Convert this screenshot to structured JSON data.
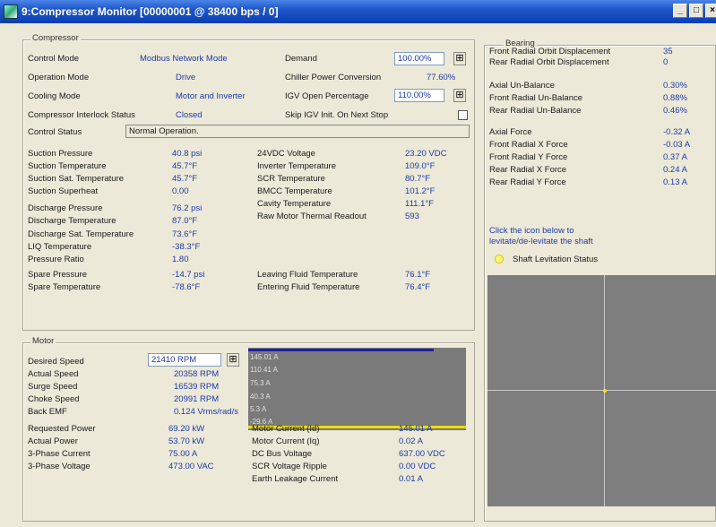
{
  "window": {
    "title": "9:Compressor Monitor [00000001 @ 38400 bps / 0]",
    "minimize": "_",
    "maximize": "□",
    "close": "×"
  },
  "compressor": {
    "group_title": "Compressor",
    "control_mode_label": "Control Mode",
    "control_mode_value": "Modbus Network Mode",
    "operation_mode_label": "Operation Mode",
    "operation_mode_value": "Drive",
    "cooling_mode_label": "Cooling Mode",
    "cooling_mode_value": "Motor and Inverter",
    "interlock_label": "Compressor Interlock Status",
    "interlock_value": "Closed",
    "control_status_label": "Control Status",
    "control_status_value": "Normal Operation.",
    "demand_label": "Demand",
    "demand_value": "100.00%",
    "chiller_power_label": "Chiller Power Conversion",
    "chiller_power_value": "77.60%",
    "igv_label": "IGV Open Percentage",
    "igv_value": "110.00%",
    "skip_igv_label": "Skip IGV Init. On Next Stop",
    "left_readings": [
      {
        "label": "Suction Pressure",
        "value": "40.8 psi"
      },
      {
        "label": "Suction Temperature",
        "value": "45.7°F"
      },
      {
        "label": "Suction Sat. Temperature",
        "value": "45.7°F"
      },
      {
        "label": "Suction Superheat",
        "value": "0.00"
      },
      {
        "label": "Discharge Pressure",
        "value": "76.2 psi"
      },
      {
        "label": "Discharge Temperature",
        "value": "87.0°F"
      },
      {
        "label": "Discharge Sat. Temperature",
        "value": "73.6°F"
      },
      {
        "label": "LIQ Temperature",
        "value": "-38.3°F"
      },
      {
        "label": "Pressure Ratio",
        "value": "1.80"
      },
      {
        "label": "Spare Pressure",
        "value": "-14.7 psi"
      },
      {
        "label": "Spare Temperature",
        "value": "-78.6°F"
      }
    ],
    "right_readings": [
      {
        "label": "24VDC Voltage",
        "value": "23.20 VDC"
      },
      {
        "label": "Inverter Temperature",
        "value": "109.0°F"
      },
      {
        "label": "SCR Temperature",
        "value": "80.7°F"
      },
      {
        "label": "BMCC Temperature",
        "value": "101.2°F"
      },
      {
        "label": "Cavity Temperature",
        "value": "111.1°F"
      },
      {
        "label": "Raw Motor Thermal Readout",
        "value": "593"
      },
      {
        "label": "Leaving Fluid Temperature",
        "value": "76.1°F"
      },
      {
        "label": "Entering Fluid Temperature",
        "value": "76.4°F"
      }
    ]
  },
  "motor": {
    "group_title": "Motor",
    "desired_speed_label": "Desired Speed",
    "desired_speed_value": "21410 RPM",
    "speeds": [
      {
        "label": "Actual Speed",
        "value": "20358 RPM"
      },
      {
        "label": "Surge Speed",
        "value": "16539 RPM"
      },
      {
        "label": "Choke Speed",
        "value": "20991 RPM"
      },
      {
        "label": "Back EMF",
        "value": "0.124 Vrms/rad/s"
      }
    ],
    "graph_labels": [
      "145.01 A",
      "110.41 A",
      "75.3 A",
      "40.3 A",
      "5.3 A",
      "-29.6 A"
    ],
    "power_left": [
      {
        "label": "Requested Power",
        "value": "69.20 kW"
      },
      {
        "label": "Actual Power",
        "value": "53.70 kW"
      },
      {
        "label": "3-Phase Current",
        "value": "75.00 A"
      },
      {
        "label": "3-Phase Voltage",
        "value": "473.00 VAC"
      }
    ],
    "power_right": [
      {
        "label": "Motor Current (Id)",
        "value": "145.01 A"
      },
      {
        "label": "Motor Current (Iq)",
        "value": "0.02 A"
      },
      {
        "label": "DC Bus Voltage",
        "value": "637.00 VDC"
      },
      {
        "label": "SCR Voltage Ripple",
        "value": "0.00 VDC"
      },
      {
        "label": "Earth Leakage Current",
        "value": "0.01 A"
      }
    ]
  },
  "bearing": {
    "group_title": "Bearing",
    "readings": [
      {
        "label": "Front Radial Orbit Displacement",
        "value": "35"
      },
      {
        "label": "Rear Radial Orbit Displacement",
        "value": "0"
      },
      {
        "label": "Axial Un-Balance",
        "value": "0.30%"
      },
      {
        "label": "Front Radial Un-Balance",
        "value": "0.88%"
      },
      {
        "label": "Rear Radial Un-Balance",
        "value": "0.46%"
      },
      {
        "label": "Axial Force",
        "value": "-0.32 A"
      },
      {
        "label": "Front Radial X Force",
        "value": "-0.03 A"
      },
      {
        "label": "Front Radial Y Force",
        "value": "0.37 A"
      },
      {
        "label": "Rear Radial X Force",
        "value": "0.24 A"
      },
      {
        "label": "Rear Radial Y Force",
        "value": "0.13 A"
      }
    ],
    "hint_line1": "Click the icon below to",
    "hint_line2": "levitate/de-levitate the shaft",
    "levitation_label": "Shaft Levitation Status"
  }
}
